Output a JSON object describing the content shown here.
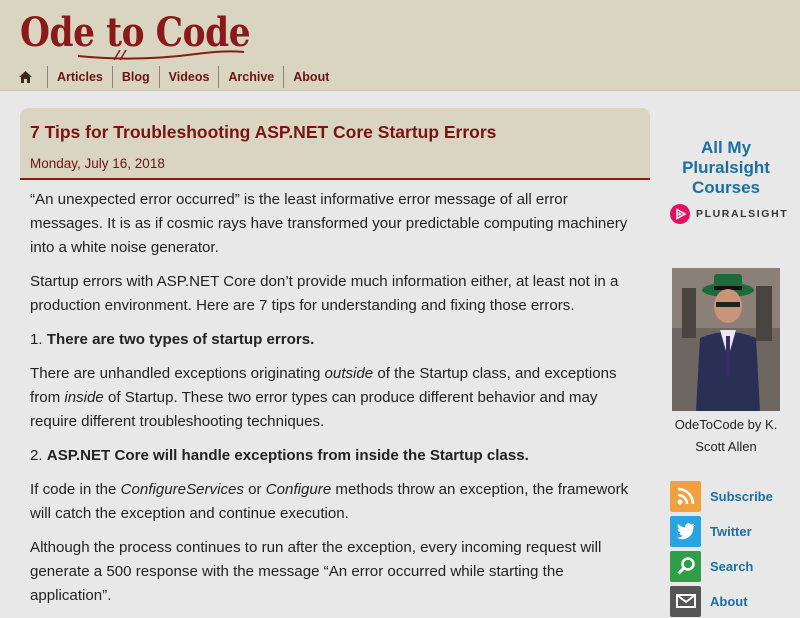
{
  "site": {
    "logo_text": "Ode to Code"
  },
  "nav": {
    "home_icon": "home-icon",
    "items": [
      {
        "label": "Articles"
      },
      {
        "label": "Blog"
      },
      {
        "label": "Videos"
      },
      {
        "label": "Archive"
      },
      {
        "label": "About"
      }
    ]
  },
  "post": {
    "title": "7 Tips for Troubleshooting ASP.NET Core Startup Errors",
    "date": "Monday, July 16, 2018",
    "p1": "“An unexpected error occurred” is the least informative error message of all error messages. It is as if cosmic rays have transformed your predictable computing machinery into a white noise generator.",
    "p2": "Startup errors with ASP.NET Core don’t provide much information either, at least not in a production environment. Here are 7 tips for understanding and fixing those errors.",
    "tip1_num": "1.",
    "tip1": "There are two types of startup errors.",
    "p3_a": "There are unhandled exceptions originating ",
    "p3_em1": "outside",
    "p3_b": " of the Startup class, and exceptions from ",
    "p3_em2": "inside",
    "p3_c": " of Startup. These two error types can produce different behavior and may require different troubleshooting techniques.",
    "tip2_num": "2.",
    "tip2": "ASP.NET Core will handle exceptions from inside the Startup class.",
    "p4_a": "If code in the ",
    "p4_em1": "ConfigureServices",
    "p4_b": " or ",
    "p4_em2": "Configure",
    "p4_c": " methods throw an exception, the framework will catch the exception and continue execution.",
    "p5": "Although the process continues to run after the exception, every incoming request will generate a 500 response with the message “An error occurred while starting the application”."
  },
  "sidebar": {
    "courses_title": "All My Pluralsight Courses",
    "pluralsight_word": "PLURALSIGHT",
    "author_caption": "OdeToCode by K. Scott Allen",
    "social": [
      {
        "label": "Subscribe",
        "icon": "rss-icon",
        "color": "#f0a040"
      },
      {
        "label": "Twitter",
        "icon": "twitter-icon",
        "color": "#2aa3e0"
      },
      {
        "label": "Search",
        "icon": "search-icon",
        "color": "#2e9e48"
      },
      {
        "label": "About",
        "icon": "mail-icon",
        "color": "#555555"
      }
    ]
  },
  "colors": {
    "header_bg": "#d9d5c0",
    "brand": "#8a1a1a",
    "link_blue": "#1a6fa6",
    "page_bg": "#e8e8e8"
  }
}
